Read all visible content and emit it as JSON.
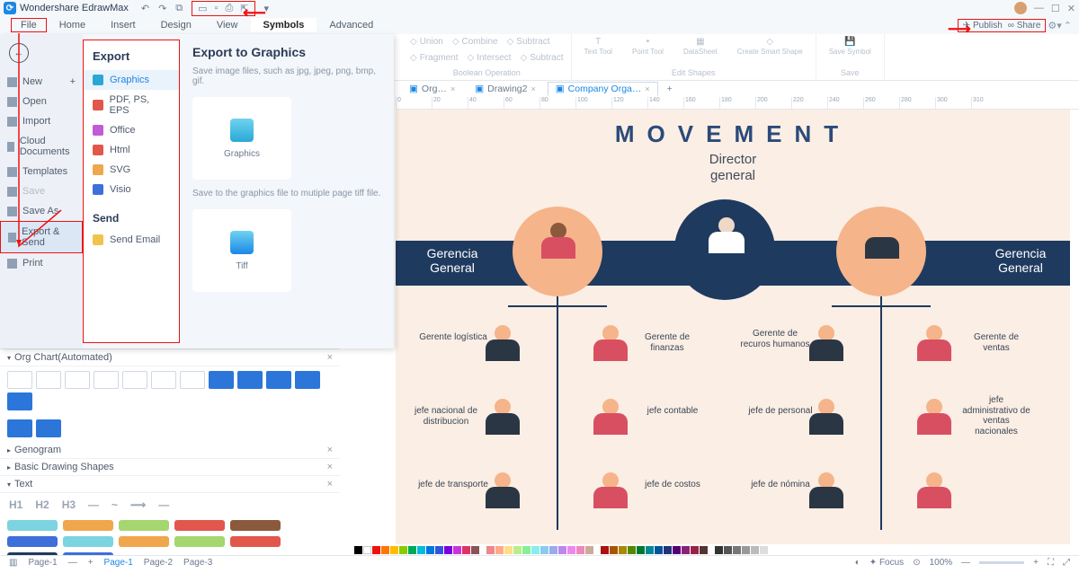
{
  "app": {
    "title": "Wondershare EdrawMax"
  },
  "menubar": {
    "file": "File",
    "home": "Home",
    "insert": "Insert",
    "design": "Design",
    "view": "View",
    "symbols": "Symbols",
    "advanced": "Advanced",
    "publish": "Publish",
    "share": "Share"
  },
  "ribbon": {
    "union": "Union",
    "combine": "Combine",
    "subtract": "Subtract",
    "fragment": "Fragment",
    "intersect": "Intersect",
    "subtract2": "Subtract",
    "text_tool": "Text Tool",
    "point_tool": "Point Tool",
    "datasheet": "DataSheet",
    "create_smart": "Create Smart Shape",
    "save_symbol": "Save Symbol",
    "group_bool": "Boolean Operation",
    "group_edit": "Edit Shapes",
    "group_save": "Save"
  },
  "doctabs": {
    "t1": "Org…",
    "t2": "Drawing2",
    "t3": "Company Orga…"
  },
  "file_menu": {
    "new": "New",
    "open": "Open",
    "import": "Import",
    "cloud": "Cloud Documents",
    "templates": "Templates",
    "save": "Save",
    "saveas": "Save As",
    "export": "Export & Send",
    "print": "Print",
    "export_h": "Export",
    "send_h": "Send",
    "graphics": "Graphics",
    "pdf": "PDF, PS, EPS",
    "office": "Office",
    "html": "Html",
    "svg": "SVG",
    "visio": "Visio",
    "sendemail": "Send Email",
    "panel_title": "Export to Graphics",
    "panel_desc": "Save image files, such as jpg, jpeg, png, bmp, gif.",
    "card1": "Graphics",
    "panel_desc2": "Save to the graphics file to mutiple page tiff file.",
    "card2": "Tiff"
  },
  "leftpane": {
    "orgchart": "Org Chart(Automated)",
    "genogram": "Genogram",
    "basic": "Basic Drawing Shapes",
    "text": "Text",
    "h1": "H1",
    "h2": "H2",
    "h3": "H3"
  },
  "canvas": {
    "title": "MOVEMENT",
    "subtitle1": "Director",
    "subtitle2": "general",
    "ger_l": "Gerencia General",
    "ger_r": "Gerencia General",
    "p1": "Gerente logística",
    "p2": "Gerente de finanzas",
    "p3": "Gerente de recuros humanos",
    "p4": "Gerente de ventas",
    "p5": "jefe nacional de distribucion",
    "p6": "jefe contable",
    "p7": "jefe de personal",
    "p8": "jefe administrativo de ventas nacionales",
    "p9": "jefe de transporte",
    "p10": "jefe de costos",
    "p11": "jefe de nómina"
  },
  "status": {
    "page1": "Page-1",
    "page2": "Page-2",
    "page3": "Page-3",
    "focus": "Focus",
    "zoom": "100%"
  },
  "ruler": [
    "0",
    "20",
    "40",
    "60",
    "80",
    "100",
    "120",
    "140",
    "160",
    "180",
    "200",
    "220",
    "240",
    "260",
    "280",
    "300",
    "310"
  ]
}
